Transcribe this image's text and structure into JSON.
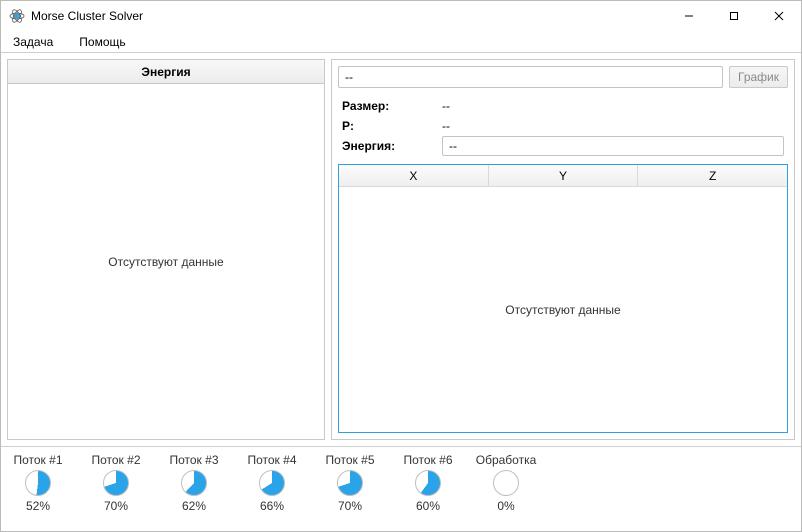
{
  "window": {
    "title": "Morse Cluster Solver"
  },
  "menu": {
    "task": "Задача",
    "help": "Помощь"
  },
  "left": {
    "header": "Энергия",
    "empty": "Отсутствуют данные"
  },
  "right": {
    "search_value": "--",
    "graph_btn": "График",
    "size_label": "Размер:",
    "size_value": "--",
    "p_label": "P:",
    "p_value": "--",
    "energy_label": "Энергия:",
    "energy_value": "--",
    "col_x": "X",
    "col_y": "Y",
    "col_z": "Z",
    "empty": "Отсутствуют данные"
  },
  "threads": [
    {
      "label": "Поток #1",
      "percent": 52,
      "percent_text": "52%"
    },
    {
      "label": "Поток #2",
      "percent": 70,
      "percent_text": "70%"
    },
    {
      "label": "Поток #3",
      "percent": 62,
      "percent_text": "62%"
    },
    {
      "label": "Поток #4",
      "percent": 66,
      "percent_text": "66%"
    },
    {
      "label": "Поток #5",
      "percent": 70,
      "percent_text": "70%"
    },
    {
      "label": "Поток #6",
      "percent": 60,
      "percent_text": "60%"
    },
    {
      "label": "Обработка",
      "percent": 0,
      "percent_text": "0%"
    }
  ],
  "colors": {
    "accent": "#2aa3e8"
  }
}
